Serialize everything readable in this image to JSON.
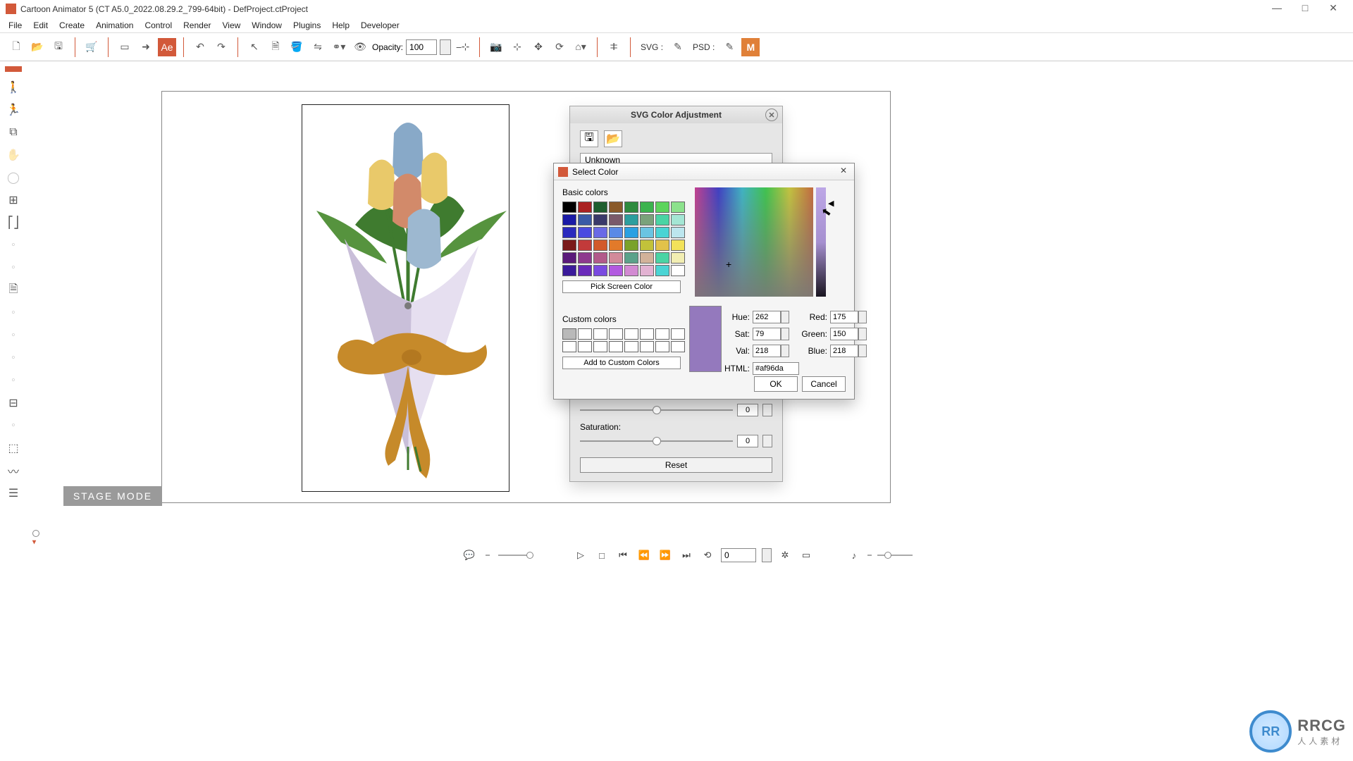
{
  "titlebar": {
    "text": "Cartoon Animator 5 (CT A5.0_2022.08.29.2_799-64bit) - DefProject.ctProject"
  },
  "menus": [
    "File",
    "Edit",
    "Create",
    "Animation",
    "Control",
    "Render",
    "View",
    "Window",
    "Plugins",
    "Help",
    "Developer"
  ],
  "toolbar": {
    "opacity_label": "Opacity:",
    "opacity_value": "100",
    "svg_label": "SVG :",
    "psd_label": "PSD :"
  },
  "stage_mode": "STAGE MODE",
  "adj_panel": {
    "title": "SVG Color Adjustment",
    "list_item": "Unknown",
    "sat_label": "Saturation:",
    "sat_value": "0",
    "slider2_value": "0",
    "reset": "Reset"
  },
  "color_dialog": {
    "title": "Select Color",
    "basic_label": "Basic colors",
    "custom_label": "Custom colors",
    "pick": "Pick Screen Color",
    "add": "Add to Custom Colors",
    "hue_label": "Hue:",
    "hue": "262",
    "sat_label": "Sat:",
    "sat": "79",
    "val_label": "Val:",
    "val": "218",
    "red_label": "Red:",
    "red": "175",
    "green_label": "Green:",
    "green": "150",
    "blue_label": "Blue:",
    "blue": "218",
    "html_label": "HTML:",
    "html": "#af96da",
    "ok": "OK",
    "cancel": "Cancel",
    "basic_colors": [
      "#000000",
      "#aa2222",
      "#1e5e2e",
      "#8a5a2a",
      "#2e8b3e",
      "#3cb34e",
      "#5cd45c",
      "#8ce28c",
      "#1a1aa6",
      "#3a5aa6",
      "#3a3a6a",
      "#7a5a6a",
      "#2c9e9e",
      "#7aa27a",
      "#4ad4a4",
      "#a4e6d4",
      "#2a2abe",
      "#4a4ae0",
      "#6a6ae6",
      "#5a8ae6",
      "#2aa0e2",
      "#6ac4e2",
      "#4ad4d4",
      "#bce6ee",
      "#7a1a1a",
      "#c23a3a",
      "#d25a2a",
      "#e27a2a",
      "#7aa22a",
      "#c2c23a",
      "#e2c24a",
      "#f2e25a",
      "#5a1a7a",
      "#8e3a8e",
      "#b25a8a",
      "#d28a9a",
      "#5aa28a",
      "#d2b29a",
      "#4ad4a4",
      "#f2eeb2",
      "#3a1a9a",
      "#6a2aba",
      "#7a4ae0",
      "#b25ae0",
      "#d28ad2",
      "#e2b2d2",
      "#4ad4d4",
      "#ffffff"
    ]
  },
  "timeline": {
    "frame": "0"
  },
  "watermark": {
    "logo": "RR",
    "line1": "RRCG",
    "line2": "人人素材"
  },
  "chart_data": null
}
